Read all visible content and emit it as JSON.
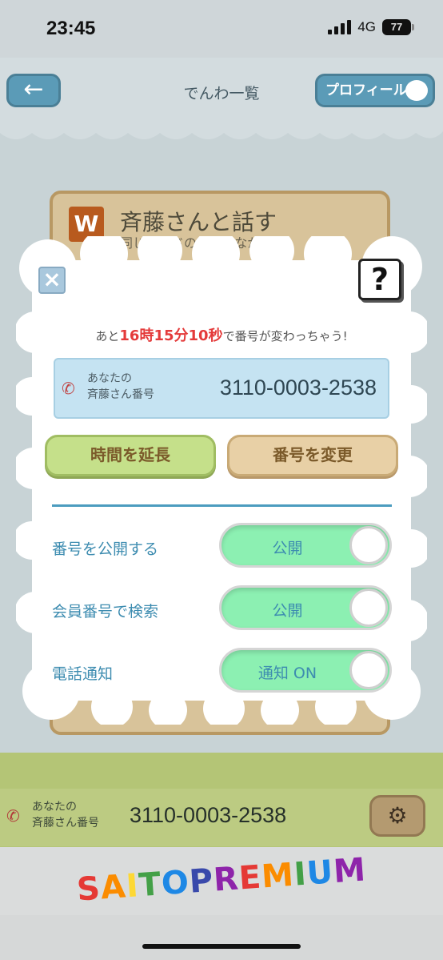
{
  "status_bar": {
    "time": "23:45",
    "network": "4G",
    "battery": "77"
  },
  "topbar": {
    "back_icon": "←",
    "title": "でんわ一覧",
    "profile_label": "プロフィール"
  },
  "background_card": {
    "badge": "W",
    "title": "斉藤さんと話す",
    "subtitle": "同じワードの人とつながると"
  },
  "modal": {
    "countdown": {
      "prefix": "あと",
      "hours": "16",
      "h_unit": "時",
      "minutes": "15",
      "m_unit": "分",
      "seconds": "10",
      "s_unit": "秒",
      "suffix": "で番号が変わっちゃう!"
    },
    "number_label_1": "あなたの",
    "number_label_2": "斉藤さん番号",
    "number_value": "3110-0003-2538",
    "extend_label": "時間を延長",
    "change_label": "番号を変更",
    "help_label": "?",
    "close_label": "×",
    "settings": [
      {
        "label": "番号を公開する",
        "toggle": "公開"
      },
      {
        "label": "会員番号で検索",
        "toggle": "公開"
      },
      {
        "label": "電話通知",
        "toggle": "通知 ON"
      }
    ]
  },
  "footer": {
    "label_1": "あなたの",
    "label_2": "斉藤さん番号",
    "number": "3110-0003-2538",
    "brand": "SAITOPREMIUM",
    "brand_colors": [
      "#e53935",
      "#fb8c00",
      "#fdd835",
      "#43a047",
      "#1e88e5",
      "#3949ab",
      "#8e24aa",
      "#e53935",
      "#fb8c00",
      "#43a047",
      "#1e88e5",
      "#8e24aa"
    ]
  },
  "icons": [
    "phone-icon",
    "gear-icon",
    "close-icon",
    "help-icon",
    "back-arrow-icon",
    "cat-icon"
  ]
}
